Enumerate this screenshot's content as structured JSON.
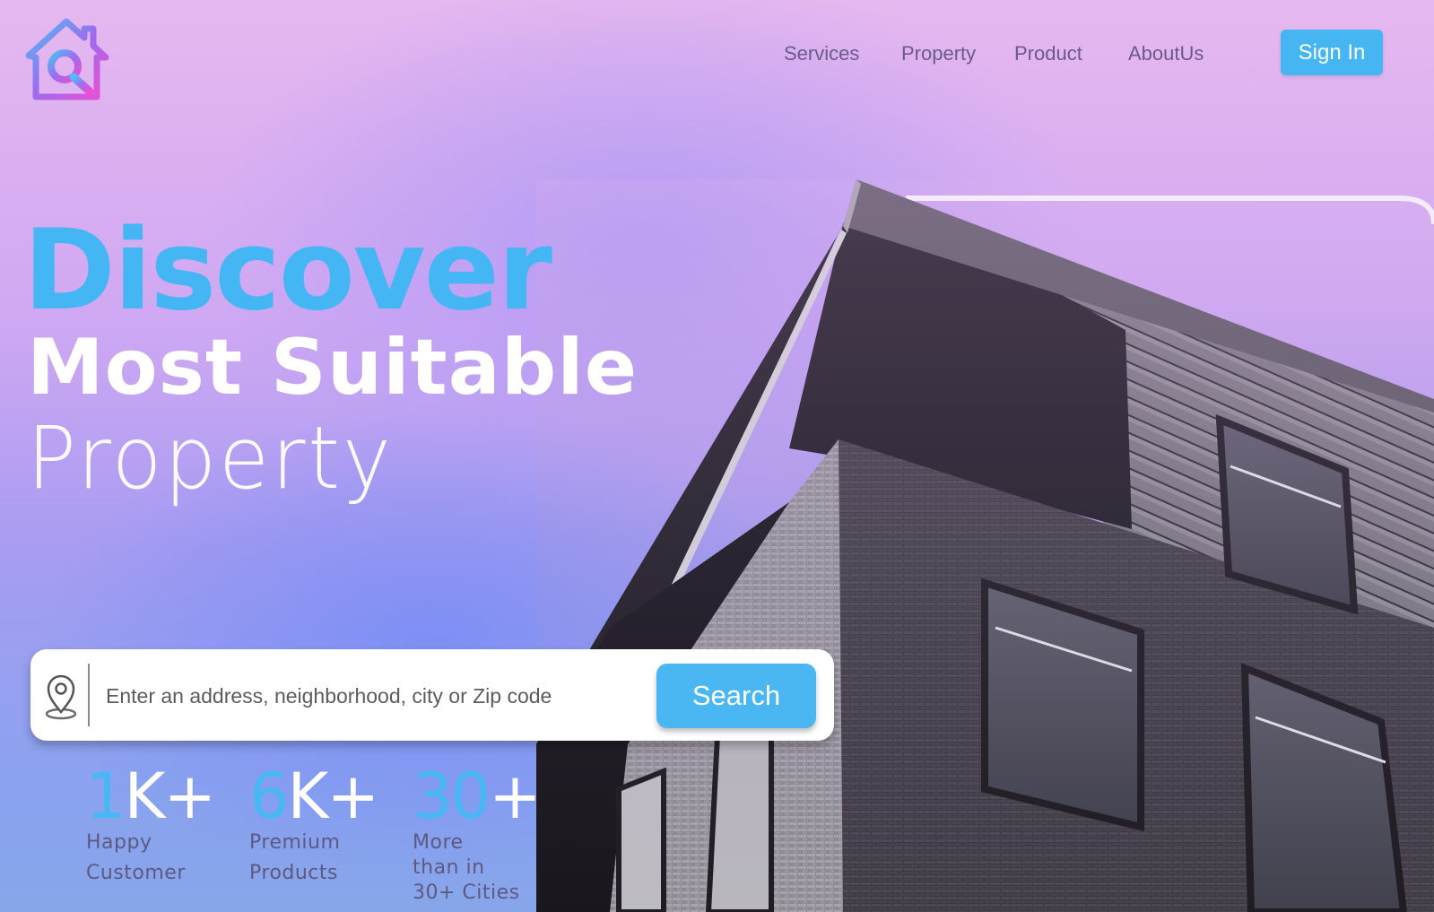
{
  "colors": {
    "accent": "#46b6f2",
    "nav_text": "#6a5b88",
    "headline_white": "#ffffff",
    "stat_label": "#5d5982"
  },
  "header": {
    "logo_icon": "house-search-icon",
    "nav": [
      {
        "label": "Services"
      },
      {
        "label": "Property"
      },
      {
        "label": "Product"
      },
      {
        "label": "AboutUs"
      }
    ],
    "signin_label": "Sign In"
  },
  "hero": {
    "line1": "Discover",
    "line2": "Most Suitable",
    "line3": "Property"
  },
  "search": {
    "icon": "location-pin-icon",
    "placeholder": "Enter an address, neighborhood, city or Zip code",
    "value": "",
    "button_label": "Search"
  },
  "stats": [
    {
      "num_accent": "1",
      "num_rest": "K+",
      "label_lines": [
        "Happy",
        "Customer"
      ]
    },
    {
      "num_accent": "6",
      "num_rest": "K+",
      "label_lines": [
        "Premium",
        "Products"
      ]
    },
    {
      "num_accent": "30",
      "num_rest": "+",
      "label_lines": [
        "More",
        "than in",
        "30+ Cities"
      ]
    }
  ]
}
